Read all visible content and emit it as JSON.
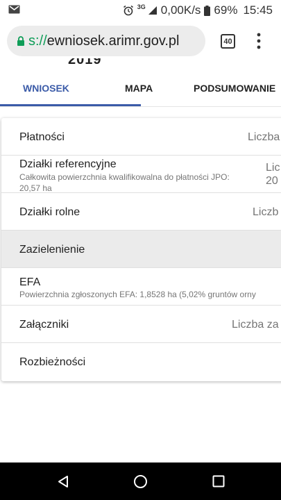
{
  "status_bar": {
    "network_type": "3G",
    "speed": "0,00K/s",
    "battery": "69%",
    "time": "15:45"
  },
  "browser": {
    "url_prefix": "s://",
    "url_host": "ewniosek.arimr.gov.pl",
    "tab_count": "40"
  },
  "page": {
    "peek_text": "2019"
  },
  "tabs": [
    {
      "label": "WNIOSEK",
      "active": true
    },
    {
      "label": "MAPA",
      "active": false
    },
    {
      "label": "PODSUMOWANIE",
      "active": false
    }
  ],
  "rows": [
    {
      "title": "Płatności",
      "right": "Liczba"
    },
    {
      "title": "Działki referencyjne",
      "subtitle": "Całkowita powierzchnia kwalifikowalna do płatności JPO: 20,57 ha",
      "right_line1": "Lic",
      "right_line2": "20"
    },
    {
      "title": "Działki rolne",
      "right": "Liczb"
    },
    {
      "title": "Zazielenienie"
    },
    {
      "title": "EFA",
      "subtitle": "Powierzchnia zgłoszonych EFA: 1,8528 ha (5,02% gruntów orny"
    },
    {
      "title": "Załączniki",
      "right": "Liczba za"
    },
    {
      "title": "Rozbieżności"
    }
  ],
  "colors": {
    "accent": "#3b5ba8",
    "secure": "#0f9d58",
    "highlight_row": "#ebebeb"
  }
}
